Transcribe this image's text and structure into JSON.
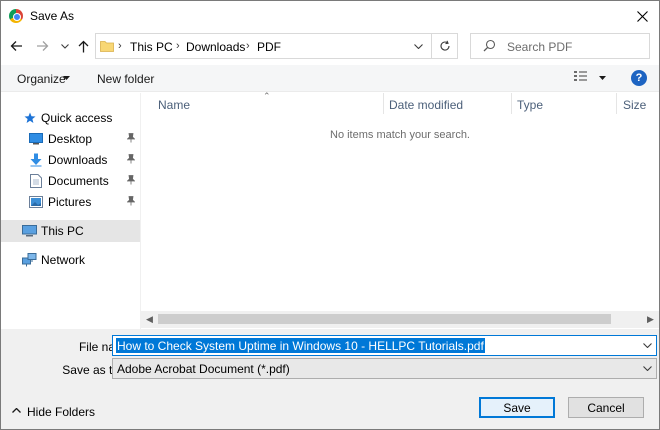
{
  "window": {
    "title": "Save As",
    "close_glyph": "✕"
  },
  "address": {
    "crumbs": [
      "This PC",
      "Downloads",
      "PDF"
    ],
    "search_placeholder": "Search PDF"
  },
  "toolbar": {
    "organize": "Organize",
    "new_folder": "New folder",
    "help": "?"
  },
  "nav": {
    "quick_access": "Quick access",
    "items": [
      {
        "label": "Desktop",
        "icon": "desktop-icon",
        "pinned": true
      },
      {
        "label": "Downloads",
        "icon": "download-arrow-icon",
        "pinned": true
      },
      {
        "label": "Documents",
        "icon": "document-icon",
        "pinned": true
      },
      {
        "label": "Pictures",
        "icon": "picture-icon",
        "pinned": true
      }
    ],
    "this_pc": "This PC",
    "network": "Network"
  },
  "content": {
    "columns": [
      "Name",
      "Date modified",
      "Type",
      "Size"
    ],
    "empty_message": "No items match your search."
  },
  "form": {
    "file_name_label": "File name:",
    "file_name_value": "How to Check System Uptime in Windows 10 - HELLPC Tutorials.pdf",
    "save_as_type_label": "Save as type:",
    "save_as_type_value": "Adobe Acrobat Document (*.pdf)"
  },
  "footer": {
    "hide_folders": "Hide Folders",
    "save": "Save",
    "cancel": "Cancel"
  },
  "colors": {
    "accent": "#0078d7",
    "help": "#1d64c2",
    "folder": "#f8d775",
    "selected_nav": "#e5e5e5"
  }
}
